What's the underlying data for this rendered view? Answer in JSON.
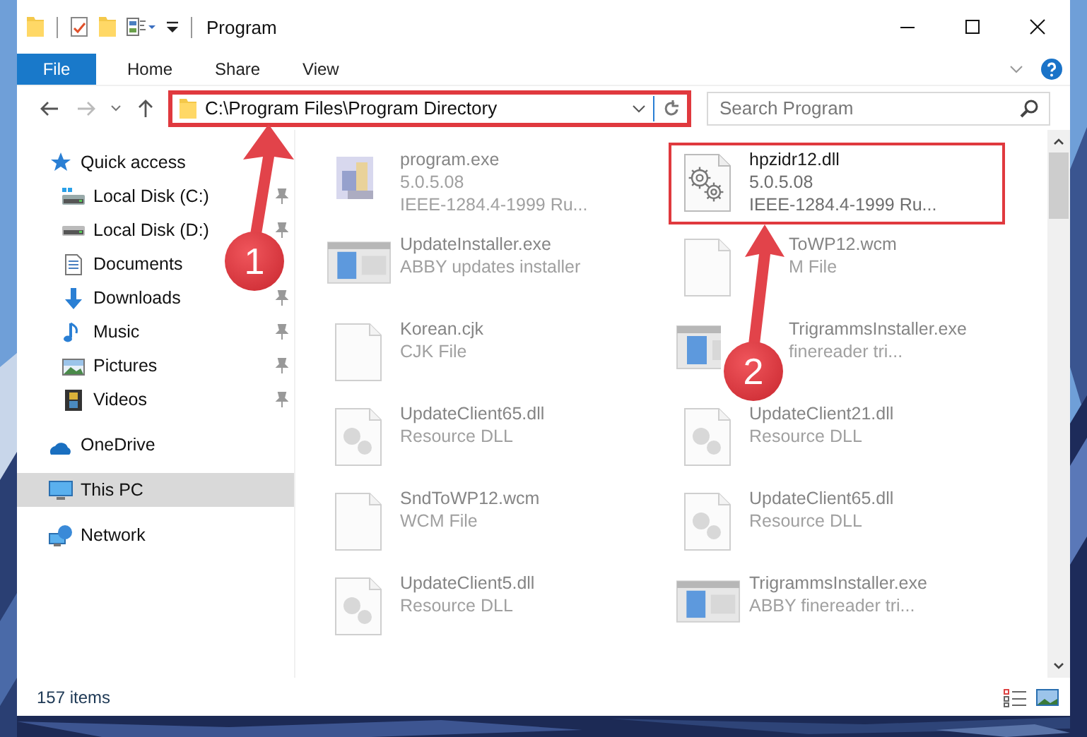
{
  "window": {
    "title": "Program"
  },
  "ribbon_tabs": [
    {
      "label": "File",
      "kind": "file"
    },
    {
      "label": "Home",
      "kind": "tab"
    },
    {
      "label": "Share",
      "kind": "tab"
    },
    {
      "label": "View",
      "kind": "tab"
    }
  ],
  "address": {
    "path": "C:\\Program Files\\Program Directory",
    "highlighted": true
  },
  "search": {
    "placeholder": "Search Program"
  },
  "sidebar": {
    "items": [
      {
        "label": "Quick access",
        "kind": "star",
        "selected": false,
        "children": [
          {
            "label": "Local Disk (C:)",
            "kind": "windrive",
            "pinned": true,
            "selected": false
          },
          {
            "label": "Local Disk (D:)",
            "kind": "drive",
            "pinned": true,
            "selected": false
          },
          {
            "label": "Documents",
            "kind": "document",
            "pinned": false,
            "selected": false
          },
          {
            "label": "Downloads",
            "kind": "download",
            "pinned": true,
            "selected": false
          },
          {
            "label": "Music",
            "kind": "music",
            "pinned": true,
            "selected": false
          },
          {
            "label": "Pictures",
            "kind": "pictures",
            "pinned": true,
            "selected": false
          },
          {
            "label": "Videos",
            "kind": "videos",
            "pinned": true,
            "selected": false
          }
        ]
      },
      {
        "label": "OneDrive",
        "kind": "cloud",
        "selected": false
      },
      {
        "label": "This PC",
        "kind": "pc",
        "selected": true
      },
      {
        "label": "Network",
        "kind": "network",
        "selected": false
      }
    ]
  },
  "files": [
    {
      "name": "program.exe",
      "details": [
        "5.0.5.08",
        "IEEE-1284.4-1999 Ru..."
      ],
      "kind": "program",
      "highlighted": false
    },
    {
      "name": "hpzidr12.dll",
      "details": [
        "5.0.5.08",
        "IEEE-1284.4-1999 Ru..."
      ],
      "kind": "settings",
      "highlighted": true
    },
    {
      "name": "UpdateInstaller.exe",
      "details": [
        "ABBY updates installer"
      ],
      "kind": "installer",
      "highlighted": false
    },
    {
      "name": "ToWP12.wcm",
      "details": [
        "M File"
      ],
      "kind": "blank",
      "highlighted": false
    },
    {
      "name": "Korean.cjk",
      "details": [
        "CJK File"
      ],
      "kind": "blank",
      "highlighted": false
    },
    {
      "name": "TrigrammsInstaller.exe",
      "details": [
        "finereader tri..."
      ],
      "kind": "installer",
      "highlighted": false
    },
    {
      "name": "UpdateClient65.dll",
      "details": [
        "Resource DLL"
      ],
      "kind": "resource",
      "highlighted": false
    },
    {
      "name": "UpdateClient21.dll",
      "details": [
        "Resource DLL"
      ],
      "kind": "resource",
      "highlighted": false
    },
    {
      "name": "SndToWP12.wcm",
      "details": [
        "WCM File"
      ],
      "kind": "blank",
      "highlighted": false
    },
    {
      "name": "UpdateClient65.dll",
      "details": [
        "Resource DLL"
      ],
      "kind": "resource",
      "highlighted": false
    },
    {
      "name": "UpdateClient5.dll",
      "details": [
        "Resource DLL"
      ],
      "kind": "resource",
      "highlighted": false
    },
    {
      "name": "TrigrammsInstaller.exe",
      "details": [
        "ABBY finereader tri..."
      ],
      "kind": "installer",
      "highlighted": false
    }
  ],
  "annotations": [
    {
      "label": "1"
    },
    {
      "label": "2"
    }
  ],
  "status_bar": {
    "count": "157 items"
  }
}
